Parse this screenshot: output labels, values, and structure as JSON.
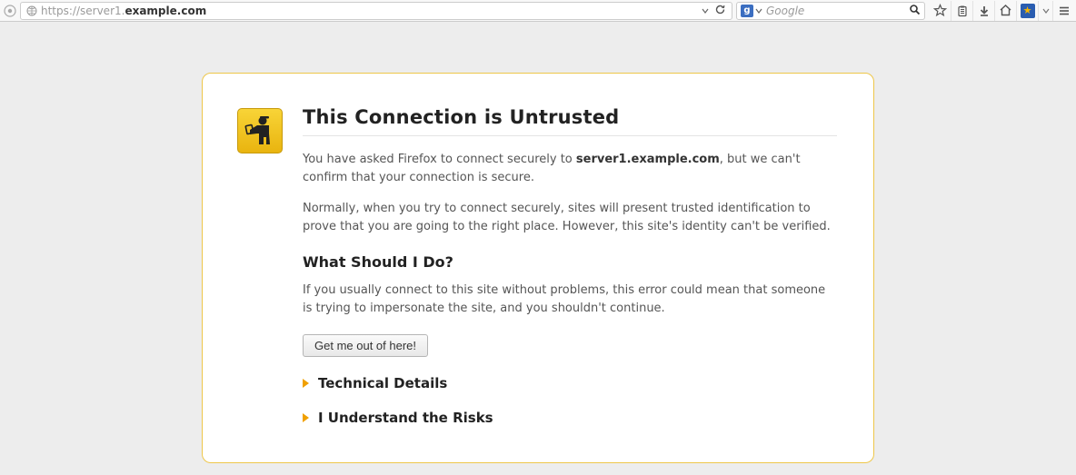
{
  "address_bar": {
    "scheme": "https://server1.",
    "host_bold": "example.com"
  },
  "search": {
    "placeholder": "Google"
  },
  "page": {
    "title": "This Connection is Untrusted",
    "para1_a": "You have asked Firefox to connect securely to ",
    "para1_host": "server1.example.com",
    "para1_b": ", but we can't confirm that your connection is secure.",
    "para2": "Normally, when you try to connect securely, sites will present trusted identification to prove that you are going to the right place. However, this site's identity can't be verified.",
    "subhead": "What Should I Do?",
    "para3": "If you usually connect to this site without problems, this error could mean that someone is trying to impersonate the site, and you shouldn't continue.",
    "button": "Get me out of here!",
    "expanders": {
      "tech": "Technical Details",
      "risks": "I Understand the Risks"
    }
  }
}
